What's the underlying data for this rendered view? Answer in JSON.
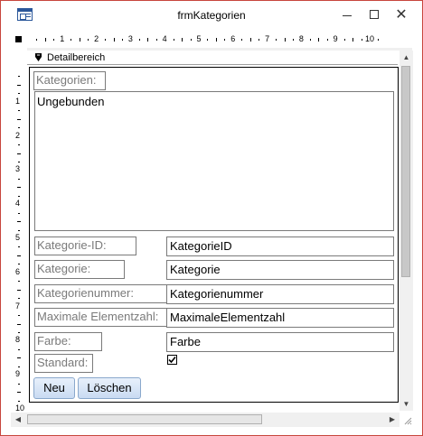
{
  "window": {
    "title": "frmKategorien",
    "controls": {
      "minimize": "–",
      "maximize": "□",
      "close": "✕"
    },
    "border_color": "#c8463d"
  },
  "ruler": {
    "horizontal_labels": [
      "1",
      "2",
      "3",
      "4",
      "5",
      "6",
      "7",
      "8",
      "9",
      "10"
    ],
    "vertical_labels": [
      "1",
      "2",
      "3",
      "4",
      "5",
      "6",
      "7",
      "8",
      "9",
      "10"
    ]
  },
  "section": {
    "label": "Detailbereich"
  },
  "form": {
    "kategorien_label": "Kategorien:",
    "listbox_value": "Ungebunden",
    "fields": [
      {
        "label": "Kategorie-ID:",
        "value": "KategorieID"
      },
      {
        "label": "Kategorie:",
        "value": "Kategorie"
      },
      {
        "label": "Kategorienummer:",
        "value": "Kategorienummer"
      },
      {
        "label": "Maximale Elementzahl:",
        "value": "MaximaleElementzahl"
      },
      {
        "label": "Farbe:",
        "value": "Farbe"
      }
    ],
    "standard_label": "Standard:",
    "standard_checked": true,
    "buttons": {
      "new": "Neu",
      "delete": "Löschen"
    }
  },
  "icons": {
    "app": "form-window-icon",
    "section": "section-marker-icon",
    "check": "checkmark-icon"
  },
  "colors": {
    "button_gradient_top": "#e8f0fb",
    "button_gradient_bottom": "#c9dbf2",
    "label_text": "#7a7a7a"
  }
}
